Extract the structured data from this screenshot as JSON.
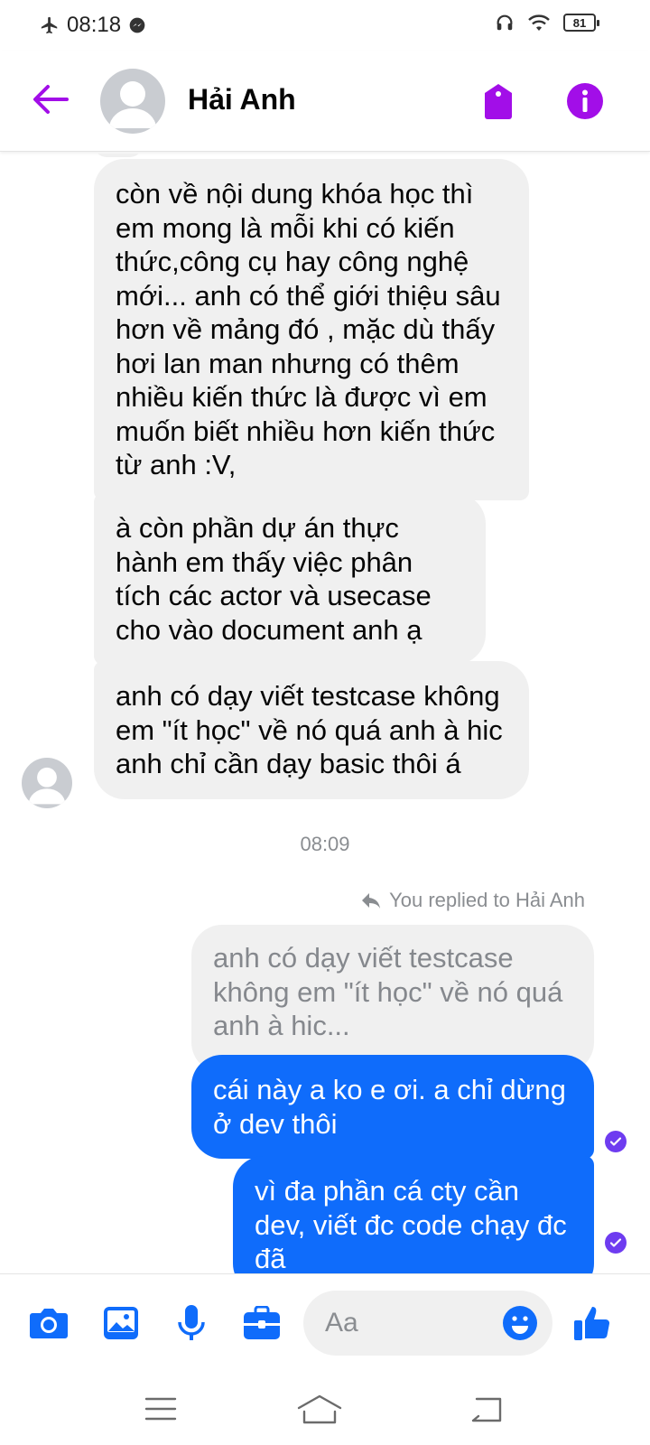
{
  "status_bar": {
    "time": "08:18",
    "battery": "81"
  },
  "header": {
    "contact_name": "Hải Anh"
  },
  "messages": {
    "incoming": [
      "còn về nội dung khóa học thì em mong là mỗi khi có kiến thức,công cụ hay công nghệ mới... anh có thể giới thiệu sâu hơn về mảng đó , mặc dù thấy hơi lan man nhưng có thêm nhiều kiến thức là được vì em muốn biết nhiều hơn kiến thức từ anh :V,",
      "à còn phần dự án thực hành em thấy việc phân tích các actor và usecase cho vào document anh ạ",
      "anh có dạy viết testcase không em \"ít học\" về nó quá anh à hic anh chỉ cần dạy basic thôi á"
    ],
    "timestamp": "08:09",
    "reply_label": "You replied to Hải Anh",
    "quoted": "anh có dạy viết testcase không em \"ít học\" về nó quá anh à hic...",
    "outgoing": [
      "cái này a ko e ơi. a chỉ dừng ở dev thôi",
      "vì đa phần cá cty cần dev, viết đc code chạy đc đã"
    ]
  },
  "composer": {
    "placeholder": "Aa",
    "tools": [
      "camera-icon",
      "image-icon",
      "microphone-icon",
      "briefcase-icon"
    ],
    "emoji_icon": "smiley-icon",
    "like_icon": "thumbs-up-icon"
  },
  "colors": {
    "accent_purple": "#a20ee8",
    "messenger_blue": "#0f6cfb",
    "incoming_bubble": "#f0f0f0",
    "read_check": "#6e3cf0"
  }
}
